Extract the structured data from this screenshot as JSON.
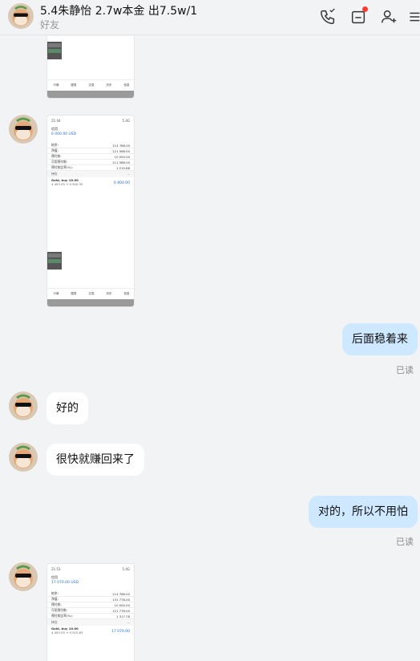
{
  "header": {
    "title": "5.4朱静怡 2.7w本金 出7.5w/1",
    "subtitle": "好友"
  },
  "messages": {
    "m1": "后面稳着来",
    "m2": "好的",
    "m3": "很快就赚回来了",
    "m4": "对的，所以不用怕"
  },
  "read_label": "已读",
  "shot1": {
    "time": "21:44",
    "signal": "5.4G",
    "account": "信用",
    "balance": "6 000.00 USD",
    "rows": [
      {
        "label": "结余:",
        "value": "114 788.00"
      },
      {
        "label": "净值:",
        "value": "121 568.00"
      },
      {
        "label": "预付款:",
        "value": "10 000.00"
      },
      {
        "label": "可用预付款:",
        "value": "111 588.00"
      },
      {
        "label": "预付款比率(%):",
        "value": "1 215.88"
      }
    ],
    "section": "持仓",
    "position": {
      "name": "Gold, buy 10.00",
      "prices": "4 493.55 → 4 500.35",
      "pl": "6 800.00"
    },
    "mini": "WT跟..."
  },
  "shot2": {
    "time": "21:53",
    "signal": "5.4G",
    "account": "信用",
    "balance": "17 070.00 USD",
    "rows": [
      {
        "label": "结余:",
        "value": "114 788.00"
      },
      {
        "label": "净值:",
        "value": "131 778.00"
      },
      {
        "label": "预付款:",
        "value": "10 000.00"
      },
      {
        "label": "可用预付款:",
        "value": "121 778.00"
      },
      {
        "label": "预付款比率(%):",
        "value": "1 317.78"
      }
    ],
    "section": "持仓",
    "position": {
      "name": "Gold, buy 10.00",
      "prices": "4 493.55 → 4 510.63",
      "pl": "17 070.00"
    }
  },
  "nav": [
    "行情",
    "图表",
    "交易",
    "历史",
    "信息"
  ],
  "colors": {
    "bubble_right": "#cde8ff",
    "bubble_left": "#ffffff",
    "background": "#f2f3f5",
    "accent": "#2a72d8"
  }
}
